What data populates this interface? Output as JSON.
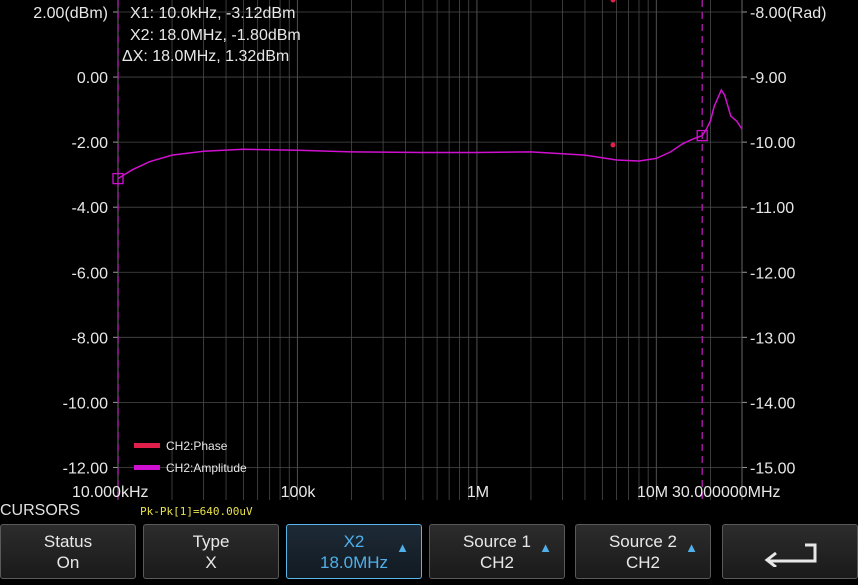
{
  "left_axis": {
    "ticks": [
      "2.00(dBm)",
      "0.00",
      "-2.00",
      "-4.00",
      "-6.00",
      "-8.00",
      "-10.00",
      "-12.00"
    ]
  },
  "right_axis": {
    "ticks": [
      "-8.00(Rad)",
      "-9.00",
      "-10.00",
      "-11.00",
      "-12.00",
      "-13.00",
      "-14.00",
      "-15.00"
    ]
  },
  "x_axis": {
    "labels": [
      "10.000kHz",
      "100k",
      "1M",
      "10M",
      "30.000000MHz"
    ]
  },
  "cursor_readout": {
    "x1": "X1: 10.0kHz, -3.12dBm",
    "x2": "X2: 18.0MHz, -1.80dBm",
    "dx": "ΔX: 18.0MHz, 1.32dBm"
  },
  "legend": [
    {
      "label": "CH2:Phase",
      "color": "#e0204a"
    },
    {
      "label": "CH2:Amplitude",
      "color": "#d010d0"
    }
  ],
  "status_bar": {
    "title": "CURSORS",
    "measurement": "Pk-Pk[1]=640.00uV"
  },
  "softkeys": {
    "status": {
      "line1": "Status",
      "line2": "On"
    },
    "type": {
      "line1": "Type",
      "line2": "X"
    },
    "x2": {
      "line1": "X2",
      "line2": "18.0MHz"
    },
    "source1": {
      "line1": "Source 1",
      "line2": "CH2"
    },
    "source2": {
      "line1": "Source 2",
      "line2": "CH2"
    }
  },
  "colors": {
    "amplitude": "#d010d0",
    "phase": "#e0204a",
    "grid": "#5a5a5a",
    "active_key": "#4fb0ea"
  },
  "icons": {
    "up_arrow": "up-arrow-icon",
    "back": "back-arrow-icon"
  },
  "chart_data": {
    "type": "line",
    "x_scale": "log",
    "xlim_hz": [
      10000,
      30000000
    ],
    "ylim_left_dbm": [
      -13,
      2
    ],
    "ylim_right_rad": [
      -15.5,
      -8
    ],
    "grid": true,
    "legend_position": "bottom-left",
    "series": [
      {
        "name": "CH2:Amplitude",
        "x_hz": [
          10000,
          12000,
          15000,
          20000,
          30000,
          50000,
          100000,
          200000,
          500000,
          1000000,
          2000000,
          4000000,
          6000000,
          8000000,
          10000000,
          12000000,
          14000000,
          16000000,
          18000000,
          19000000,
          20000000,
          21000000,
          23000000,
          24000000,
          26000000,
          28000000,
          30000000
        ],
        "y_dbm": [
          -3.12,
          -2.85,
          -2.6,
          -2.4,
          -2.28,
          -2.22,
          -2.25,
          -2.3,
          -2.32,
          -2.32,
          -2.3,
          -2.4,
          -2.55,
          -2.58,
          -2.5,
          -2.3,
          -2.05,
          -1.9,
          -1.8,
          -1.6,
          -1.35,
          -0.9,
          -0.4,
          -0.55,
          -1.2,
          -1.35,
          -1.6
        ]
      }
    ],
    "markers": [
      {
        "name": "X1",
        "x_hz": 10000,
        "y_dbm": -3.12
      },
      {
        "name": "X2",
        "x_hz": 18000000,
        "y_dbm": -1.8
      }
    ]
  }
}
